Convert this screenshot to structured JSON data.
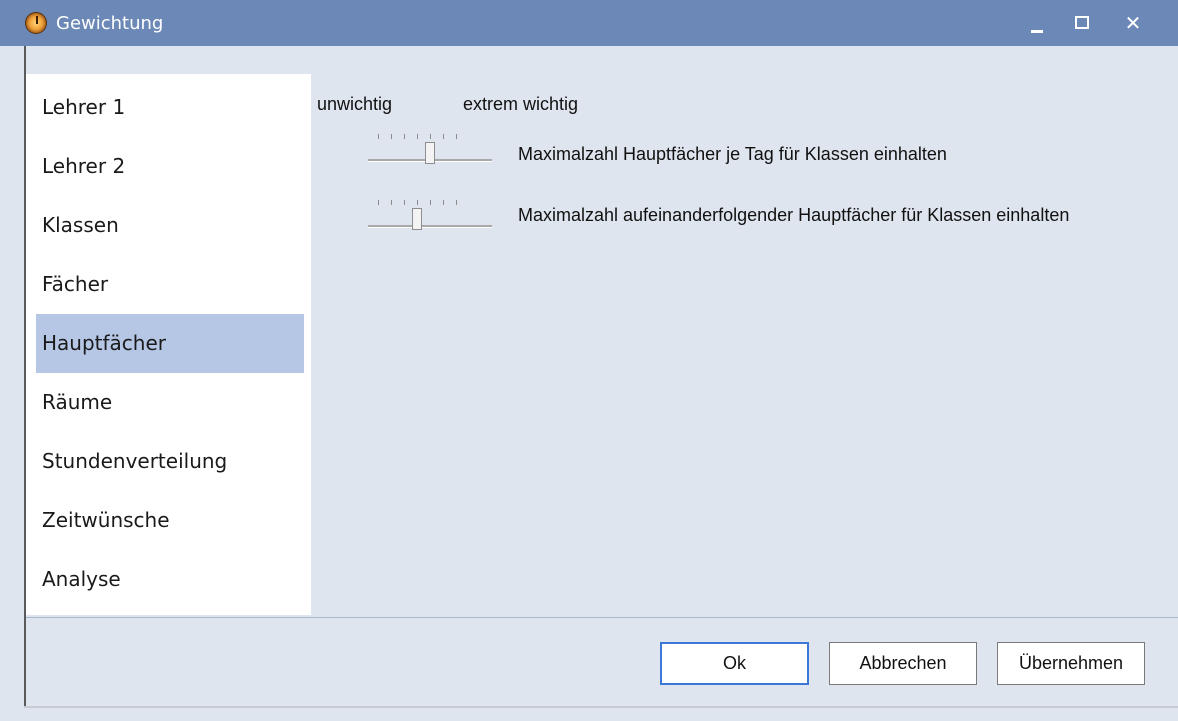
{
  "window": {
    "title": "Gewichtung",
    "controls": {
      "minimize": "–",
      "maximize": "☐",
      "close": "✕"
    }
  },
  "nav": {
    "selected_index": 4,
    "items": [
      {
        "label": "Lehrer 1"
      },
      {
        "label": "Lehrer 2"
      },
      {
        "label": "Klassen"
      },
      {
        "label": "Fächer"
      },
      {
        "label": "Hauptfächer"
      },
      {
        "label": "Räume"
      },
      {
        "label": "Stundenverteilung"
      },
      {
        "label": "Zeitwünsche"
      },
      {
        "label": "Analyse"
      }
    ]
  },
  "scale": {
    "low_label": "unwichtig",
    "high_label": "extrem wichtig"
  },
  "weights": [
    {
      "label": "Maximalzahl Hauptfächer je Tag für Klassen einhalten",
      "ticks": 7,
      "value": 4
    },
    {
      "label": "Maximalzahl aufeinanderfolgender Hauptfächer für Klassen einhalten",
      "ticks": 7,
      "value": 3
    }
  ],
  "buttons": {
    "ok": "Ok",
    "cancel": "Abbrechen",
    "apply": "Übernehmen"
  },
  "colors": {
    "titlebar": "#6b88b7",
    "window_bg": "#dfe5ee",
    "nav_selected": "#b6c7e6"
  }
}
